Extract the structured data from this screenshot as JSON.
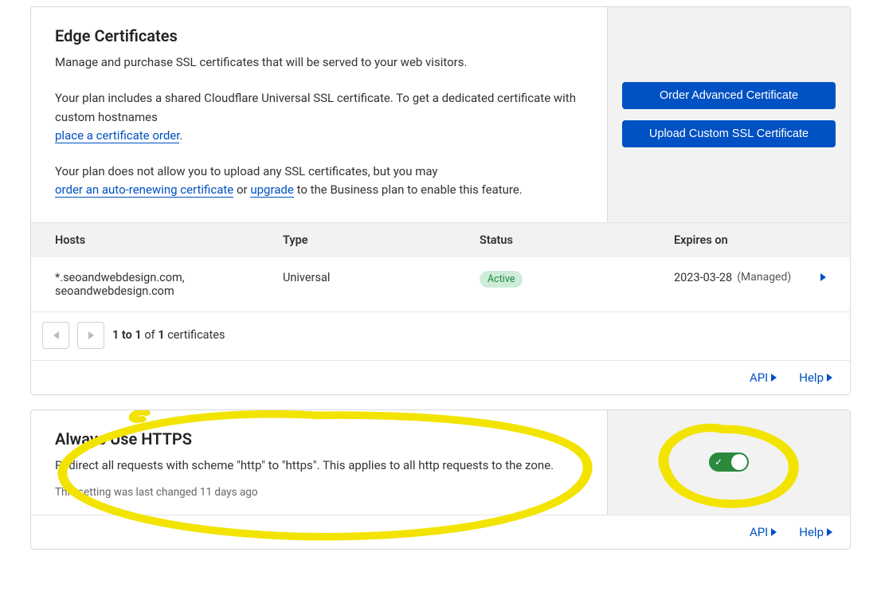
{
  "edge": {
    "title": "Edge Certificates",
    "intro": "Manage and purchase SSL certificates that will be served to your web visitors.",
    "plan_line_a": "Your plan includes a shared Cloudflare Universal SSL certificate. To get a dedicated certificate with custom hostnames",
    "link_place_order": "place a certificate order",
    "no_upload_line_a": "Your plan does not allow you to upload any SSL certificates, but you may",
    "link_auto_renew": "order an auto-renewing certificate",
    "or_word": "or",
    "link_upgrade": "upgrade",
    "no_upload_line_b": "to the Business plan to enable this feature.",
    "btn_order_adv": "Order Advanced Certificate",
    "btn_upload_custom": "Upload Custom SSL Certificate",
    "cols": {
      "hosts": "Hosts",
      "type": "Type",
      "status": "Status",
      "expires": "Expires on"
    },
    "rows": [
      {
        "hosts": "*.seoandwebdesign.com, seoandwebdesign.com",
        "type": "Universal",
        "status": "Active",
        "expires": "2023-03-28",
        "managed": "(Managed)"
      }
    ],
    "pagination_html_parts": {
      "a": "1 to 1",
      "b": "of",
      "c": "1",
      "d": "certificates"
    },
    "footer": {
      "api": "API",
      "help": "Help"
    }
  },
  "https": {
    "title": "Always Use HTTPS",
    "desc": "Redirect all requests with scheme \"http\" to \"https\". This applies to all http requests to the zone.",
    "note": "This setting was last changed 11 days ago",
    "toggle_on": true,
    "footer": {
      "api": "API",
      "help": "Help"
    }
  }
}
